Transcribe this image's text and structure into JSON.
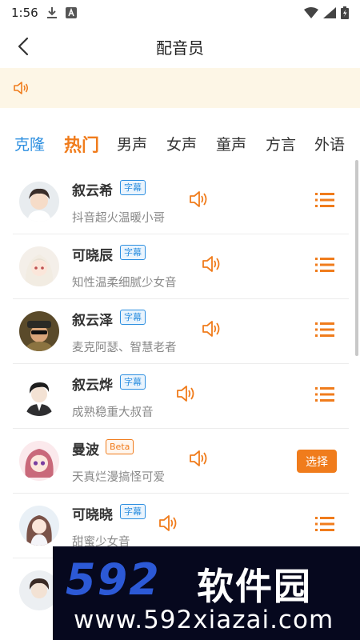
{
  "status_bar": {
    "time": "1:56"
  },
  "header": {
    "title": "配音员"
  },
  "tabs": [
    {
      "label": "克隆"
    },
    {
      "label": "热门"
    },
    {
      "label": "男声"
    },
    {
      "label": "女声"
    },
    {
      "label": "童声"
    },
    {
      "label": "方言"
    },
    {
      "label": "外语"
    }
  ],
  "active_tab": "热门",
  "voices": [
    {
      "name": "叙云希",
      "badge": "字幕",
      "desc": "抖音超火温暖小哥",
      "action": "menu"
    },
    {
      "name": "可晓辰",
      "badge": "字幕",
      "desc": "知性温柔细腻少女音",
      "action": "menu"
    },
    {
      "name": "叙云泽",
      "badge": "字幕",
      "desc": "麦克阿瑟、智慧老者",
      "action": "menu"
    },
    {
      "name": "叙云烨",
      "badge": "字幕",
      "desc": "成熟稳重大叔音",
      "action": "menu"
    },
    {
      "name": "曼波",
      "badge": "Beta",
      "desc": "天真烂漫搞怪可爱",
      "action": "select"
    },
    {
      "name": "可晓晓",
      "badge": "字幕",
      "desc": "甜蜜少女音",
      "action": "menu"
    }
  ],
  "select_label": "选择",
  "watermark": {
    "logo": "592",
    "name": "软件园",
    "url": "www.592xiazai.com"
  },
  "colors": {
    "accent_orange": "#f07c1c",
    "accent_blue": "#2d8fe0",
    "notice_bg": "#fdf6e6"
  }
}
